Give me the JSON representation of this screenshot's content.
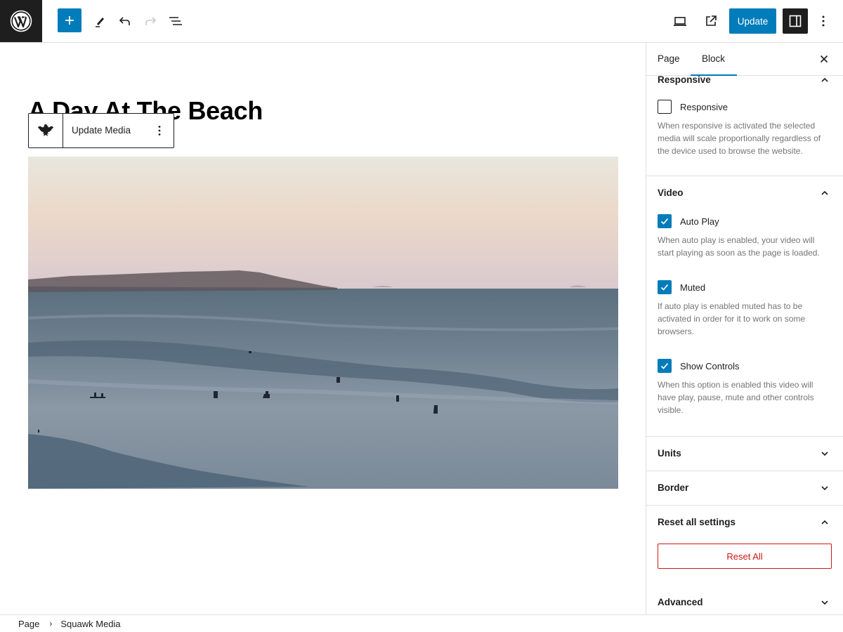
{
  "topbar": {
    "logo": "wordpress-logo",
    "add_block_label": "Add block",
    "tools": [
      "pencil-icon",
      "undo-icon",
      "redo-icon",
      "list-view-icon"
    ],
    "preview_label": "Preview",
    "view_page_label": "View page",
    "update_label": "Update",
    "settings_label": "Settings",
    "options_label": "Options"
  },
  "canvas": {
    "title": "A Day At The Beach",
    "block_toolbar": {
      "block_icon": "squawk-eagle-icon",
      "update_media_label": "Update Media",
      "more_label": "More options"
    },
    "video": {
      "description": "Ocean beach at dusk with surfers in the water and a headland on the horizon"
    }
  },
  "sidebar": {
    "tabs": [
      {
        "label": "Page",
        "active": false
      },
      {
        "label": "Block",
        "active": true
      }
    ],
    "close_label": "Close settings",
    "panels": {
      "responsive": {
        "title": "Responsive",
        "expanded": true,
        "options": [
          {
            "label": "Responsive",
            "checked": false,
            "help": "When responsive is activated the selected media will scale proportionally regardless of the device used to browse the website."
          }
        ]
      },
      "video": {
        "title": "Video",
        "expanded": true,
        "options": [
          {
            "label": "Auto Play",
            "checked": true,
            "help": "When auto play is enabled, your video will start playing as soon as the page is loaded."
          },
          {
            "label": "Muted",
            "checked": true,
            "help": "If auto play is enabled muted has to be activated in order for it to work on some browsers."
          },
          {
            "label": "Show Controls",
            "checked": true,
            "help": "When this option is enabled this video will have play, pause, mute and other controls visible."
          }
        ]
      },
      "units": {
        "title": "Units",
        "expanded": false
      },
      "border": {
        "title": "Border",
        "expanded": false
      },
      "reset": {
        "title": "Reset all settings",
        "expanded": true,
        "button_label": "Reset All"
      },
      "advanced": {
        "title": "Advanced",
        "expanded": false
      }
    }
  },
  "breadcrumb": {
    "items": [
      "Page",
      "Squawk Media"
    ],
    "separator": "›"
  },
  "colors": {
    "accent": "#007cba",
    "dark": "#1e1e1e",
    "danger": "#cc1818",
    "help_text": "#757575",
    "border": "#e0e0e0"
  }
}
